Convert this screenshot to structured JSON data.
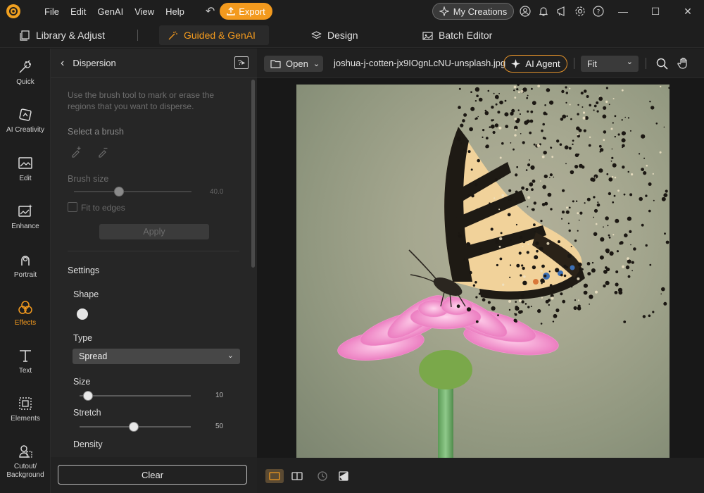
{
  "menu": [
    "File",
    "Edit",
    "GenAI",
    "View",
    "Help"
  ],
  "export_label": "Export",
  "mycreations_label": "My Creations",
  "tabs": [
    {
      "label": "Library & Adjust",
      "active": false
    },
    {
      "label": "Guided & GenAI",
      "active": true
    },
    {
      "label": "Design",
      "active": false
    },
    {
      "label": "Batch Editor",
      "active": false
    }
  ],
  "rail": [
    {
      "label": "Quick",
      "icon": "wand-icon",
      "active": false
    },
    {
      "label": "AI Creativity",
      "icon": "ai-creativity-icon",
      "active": false
    },
    {
      "label": "Edit",
      "icon": "edit-image-icon",
      "active": false
    },
    {
      "label": "Enhance",
      "icon": "enhance-icon",
      "active": false
    },
    {
      "label": "Portrait",
      "icon": "portrait-icon",
      "active": false
    },
    {
      "label": "Effects",
      "icon": "effects-icon",
      "active": true
    },
    {
      "label": "Text",
      "icon": "text-icon",
      "active": false
    },
    {
      "label": "Elements",
      "icon": "elements-icon",
      "active": false
    },
    {
      "label": "Cutout/\nBackground",
      "icon": "cutout-icon",
      "active": false
    }
  ],
  "panel": {
    "title": "Dispersion",
    "hint": "Use the brush tool to mark or erase the regions that you want to disperse.",
    "select_brush": "Select a brush",
    "brush_size_label": "Brush size",
    "brush_size_value": "40.0",
    "fit_to_edges": "Fit to edges",
    "apply": "Apply",
    "settings": "Settings",
    "shape": "Shape",
    "type_label": "Type",
    "type_value": "Spread",
    "size_label": "Size",
    "size_value": "10",
    "stretch_label": "Stretch",
    "stretch_value": "50",
    "density_label": "Density",
    "clear": "Clear"
  },
  "editor": {
    "open_label": "Open",
    "filename": "joshua-j-cotten-jx9IOgnLcNU-unsplash.jpg",
    "agent_label": "AI Agent",
    "zoom_value": "Fit"
  },
  "colors": {
    "accent": "#f39a1e",
    "bg": "#1c1c1c",
    "panel": "#262626"
  }
}
